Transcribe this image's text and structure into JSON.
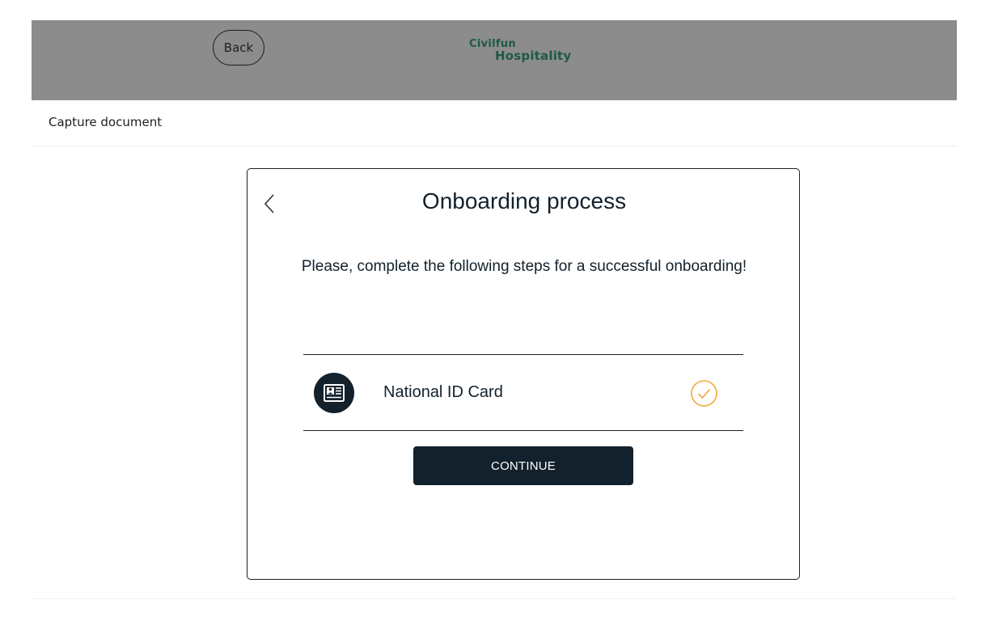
{
  "header": {
    "back_label": "Back",
    "logo_line1": "Civilfun",
    "logo_line2": "Hospitality",
    "bar_color": "#8c8c8c",
    "logo_color": "#1c5a44"
  },
  "subheader": {
    "title": "Capture document"
  },
  "card": {
    "back_icon": "chevron-left-icon",
    "title": "Onboarding process",
    "description": "Please, complete the following steps for a successful onboarding!",
    "steps": [
      {
        "icon": "id-card-icon",
        "label": "National ID Card",
        "status": "completed",
        "status_icon": "check-circle-icon",
        "status_color": "#f0a83a"
      }
    ],
    "continue_label": "CONTINUE",
    "primary_color": "#13212c"
  }
}
